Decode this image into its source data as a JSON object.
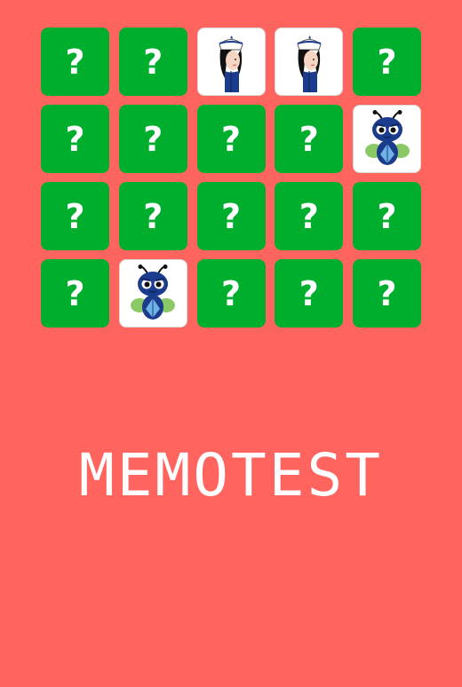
{
  "game": {
    "title": "MEMOTEST",
    "hidden_symbol": "?",
    "columns": 5,
    "rows": 4,
    "cards": [
      {
        "state": "hidden",
        "face": ""
      },
      {
        "state": "hidden",
        "face": ""
      },
      {
        "state": "revealed",
        "face": "nurse-icon"
      },
      {
        "state": "revealed",
        "face": "nurse-icon"
      },
      {
        "state": "hidden",
        "face": ""
      },
      {
        "state": "hidden",
        "face": ""
      },
      {
        "state": "hidden",
        "face": ""
      },
      {
        "state": "hidden",
        "face": ""
      },
      {
        "state": "hidden",
        "face": ""
      },
      {
        "state": "revealed",
        "face": "bug-mascot-icon"
      },
      {
        "state": "hidden",
        "face": ""
      },
      {
        "state": "hidden",
        "face": ""
      },
      {
        "state": "hidden",
        "face": ""
      },
      {
        "state": "hidden",
        "face": ""
      },
      {
        "state": "hidden",
        "face": ""
      },
      {
        "state": "hidden",
        "face": ""
      },
      {
        "state": "revealed",
        "face": "bug-mascot-icon"
      },
      {
        "state": "hidden",
        "face": ""
      },
      {
        "state": "hidden",
        "face": ""
      },
      {
        "state": "hidden",
        "face": ""
      }
    ]
  },
  "colors": {
    "background": "#FF645F",
    "card_back": "#00AE2D",
    "card_front": "#FFFFFF",
    "text": "#FFFFFF"
  }
}
